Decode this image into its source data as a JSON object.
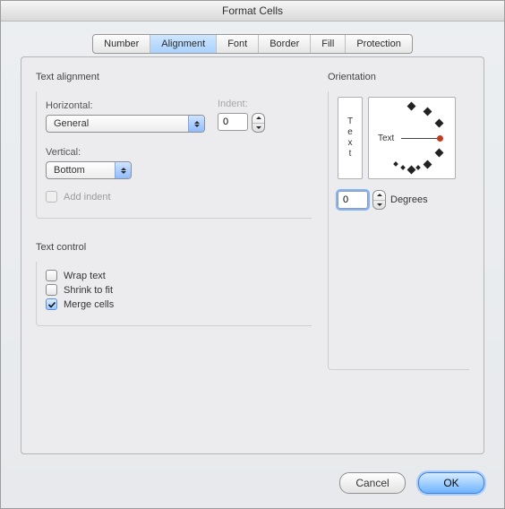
{
  "title": "Format Cells",
  "tabs": [
    "Number",
    "Alignment",
    "Font",
    "Border",
    "Fill",
    "Protection"
  ],
  "active_tab_index": 1,
  "text_alignment": {
    "title": "Text alignment",
    "horizontal_label": "Horizontal:",
    "horizontal_value": "General",
    "indent_label": "Indent:",
    "indent_value": "0",
    "vertical_label": "Vertical:",
    "vertical_value": "Bottom",
    "add_indent": {
      "label": "Add indent",
      "checked": false,
      "enabled": false
    }
  },
  "text_control": {
    "title": "Text control",
    "wrap": {
      "label": "Wrap text",
      "checked": false
    },
    "shrink": {
      "label": "Shrink to fit",
      "checked": false
    },
    "merge": {
      "label": "Merge cells",
      "checked": true
    }
  },
  "orientation": {
    "title": "Orientation",
    "vertical_word": "Text",
    "dial_label": "Text",
    "degrees_value": "0",
    "degrees_label": "Degrees"
  },
  "buttons": {
    "cancel": "Cancel",
    "ok": "OK"
  }
}
